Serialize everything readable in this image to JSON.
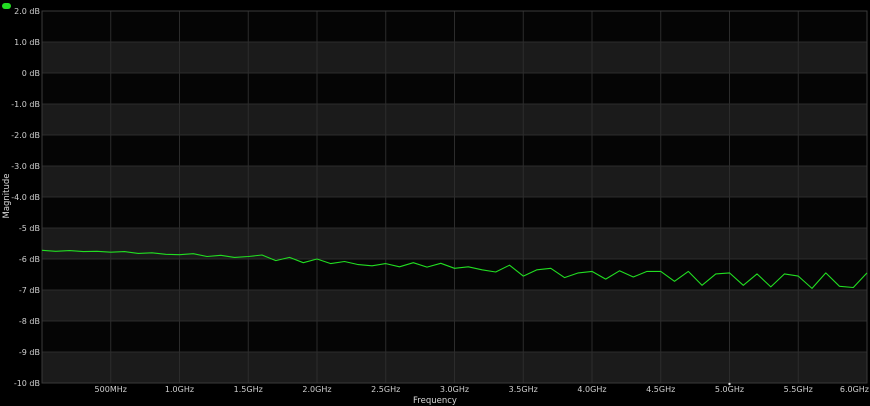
{
  "chart_data": {
    "type": "line",
    "title": "",
    "xlabel": "Frequency",
    "ylabel": "Magnitude",
    "xlim": [
      0,
      6.0
    ],
    "ylim": [
      -10,
      2
    ],
    "x_unit": "GHz",
    "y_unit": "dB",
    "grid": true,
    "legend": "top-left",
    "x_ticks": [
      {
        "value": 0.5,
        "label": "500MHz"
      },
      {
        "value": 1.0,
        "label": "1.0GHz"
      },
      {
        "value": 1.5,
        "label": "1.5GHz"
      },
      {
        "value": 2.0,
        "label": "2.0GHz"
      },
      {
        "value": 2.5,
        "label": "2.5GHz"
      },
      {
        "value": 3.0,
        "label": "3.0GHz"
      },
      {
        "value": 3.5,
        "label": "3.5GHz"
      },
      {
        "value": 4.0,
        "label": "4.0GHz"
      },
      {
        "value": 4.5,
        "label": "4.5GHz"
      },
      {
        "value": 5.0,
        "label": "5.0GHz"
      },
      {
        "value": 5.5,
        "label": "5.5GHz"
      },
      {
        "value": 6.0,
        "label": "6.0GHz"
      }
    ],
    "y_ticks": [
      {
        "value": 2,
        "label": "2.0 dB"
      },
      {
        "value": 1,
        "label": "1.0 dB"
      },
      {
        "value": 0,
        "label": "0 dB"
      },
      {
        "value": -1,
        "label": "-1.0 dB"
      },
      {
        "value": -2,
        "label": "-2.0 dB"
      },
      {
        "value": -3,
        "label": "-3.0 dB"
      },
      {
        "value": -4,
        "label": "-4.0 dB"
      },
      {
        "value": -5,
        "label": "-5 dB"
      },
      {
        "value": -6,
        "label": "-6 dB"
      },
      {
        "value": -7,
        "label": "-7 dB"
      },
      {
        "value": -8,
        "label": "-8 dB"
      },
      {
        "value": -9,
        "label": "-9 dB"
      },
      {
        "value": -10,
        "label": "-10 dB"
      }
    ],
    "series": [
      {
        "color": "#22dd22",
        "x": [
          0.0,
          0.1,
          0.2,
          0.3,
          0.4,
          0.5,
          0.6,
          0.7,
          0.8,
          0.9,
          1.0,
          1.1,
          1.2,
          1.3,
          1.4,
          1.5,
          1.6,
          1.7,
          1.8,
          1.9,
          2.0,
          2.1,
          2.2,
          2.3,
          2.4,
          2.5,
          2.6,
          2.7,
          2.8,
          2.9,
          3.0,
          3.1,
          3.2,
          3.3,
          3.4,
          3.5,
          3.6,
          3.7,
          3.8,
          3.9,
          4.0,
          4.1,
          4.2,
          4.3,
          4.4,
          4.5,
          4.6,
          4.7,
          4.8,
          4.9,
          5.0,
          5.1,
          5.2,
          5.3,
          5.4,
          5.5,
          5.6,
          5.7,
          5.8,
          5.9,
          6.0
        ],
        "y": [
          -5.72,
          -5.75,
          -5.73,
          -5.76,
          -5.75,
          -5.78,
          -5.76,
          -5.82,
          -5.8,
          -5.85,
          -5.86,
          -5.83,
          -5.92,
          -5.88,
          -5.95,
          -5.92,
          -5.87,
          -6.05,
          -5.95,
          -6.12,
          -6.0,
          -6.15,
          -6.08,
          -6.18,
          -6.22,
          -6.15,
          -6.25,
          -6.12,
          -6.26,
          -6.14,
          -6.3,
          -6.25,
          -6.35,
          -6.42,
          -6.2,
          -6.55,
          -6.35,
          -6.3,
          -6.6,
          -6.45,
          -6.4,
          -6.65,
          -6.38,
          -6.58,
          -6.4,
          -6.4,
          -6.72,
          -6.4,
          -6.85,
          -6.48,
          -6.45,
          -6.85,
          -6.48,
          -6.9,
          -6.48,
          -6.55,
          -6.95,
          -6.45,
          -6.88,
          -6.92,
          -6.45
        ]
      }
    ]
  }
}
